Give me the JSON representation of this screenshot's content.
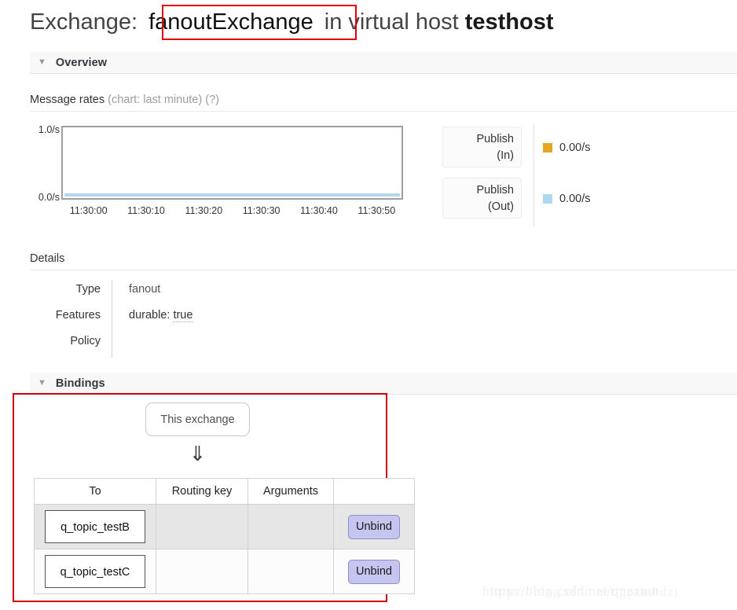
{
  "title": {
    "prefix": "Exchange:",
    "exchange_name": "fanoutExchange",
    "middle": "in virtual host",
    "vhost": "testhost"
  },
  "sections": {
    "overview": {
      "label": "Overview",
      "toggle_icon": "caret-down-icon"
    },
    "bindings": {
      "label": "Bindings",
      "toggle_icon": "caret-down-icon"
    }
  },
  "message_rates": {
    "heading": "Message rates",
    "heading_note": "(chart: last minute)",
    "help": "(?)"
  },
  "chart_data": {
    "type": "line",
    "title": "Message rates",
    "subtitle": "(chart: last minute)",
    "xlabel": "",
    "ylabel": "",
    "ylim": [
      0,
      1
    ],
    "y_ticks": [
      "0.0/s",
      "1.0/s"
    ],
    "x_ticks": [
      "11:30:00",
      "11:30:10",
      "11:30:20",
      "11:30:30",
      "11:30:40",
      "11:30:50"
    ],
    "grid": false,
    "legend_position": "right",
    "series": [
      {
        "name": "Publish (In)",
        "color": "#e5a823",
        "value_label": "0.00/s",
        "values": [
          0,
          0,
          0,
          0,
          0,
          0
        ]
      },
      {
        "name": "Publish (Out)",
        "color": "#add8ef",
        "value_label": "0.00/s",
        "values": [
          0,
          0,
          0,
          0,
          0,
          0
        ]
      }
    ]
  },
  "rate_blocks": [
    {
      "line1": "Publish",
      "line2": "(In)"
    },
    {
      "line1": "Publish",
      "line2": "(Out)"
    }
  ],
  "legend": [
    {
      "color": "#e5a823",
      "value": "0.00/s"
    },
    {
      "color": "#add8ef",
      "value": "0.00/s"
    }
  ],
  "details": {
    "heading": "Details",
    "rows": [
      {
        "key": "Type",
        "value": "fanout"
      },
      {
        "key": "Features",
        "value_prefix": "durable: ",
        "value_dotted": "true"
      },
      {
        "key": "Policy",
        "value": ""
      }
    ]
  },
  "bindings": {
    "source_node": "This exchange",
    "arrow_glyph": "⇓",
    "columns": [
      "To",
      "Routing key",
      "Arguments",
      ""
    ],
    "rows": [
      {
        "to": "q_topic_testB",
        "routing_key": "",
        "arguments": "",
        "action": "Unbind"
      },
      {
        "to": "q_topic_testC",
        "routing_key": "",
        "arguments": "",
        "action": "Unbind"
      }
    ]
  },
  "watermark": {
    "text": "https://blog.csdn.net/qpeanut",
    "overlay": "https://blog.csdn.net/qpzmbdzj"
  }
}
